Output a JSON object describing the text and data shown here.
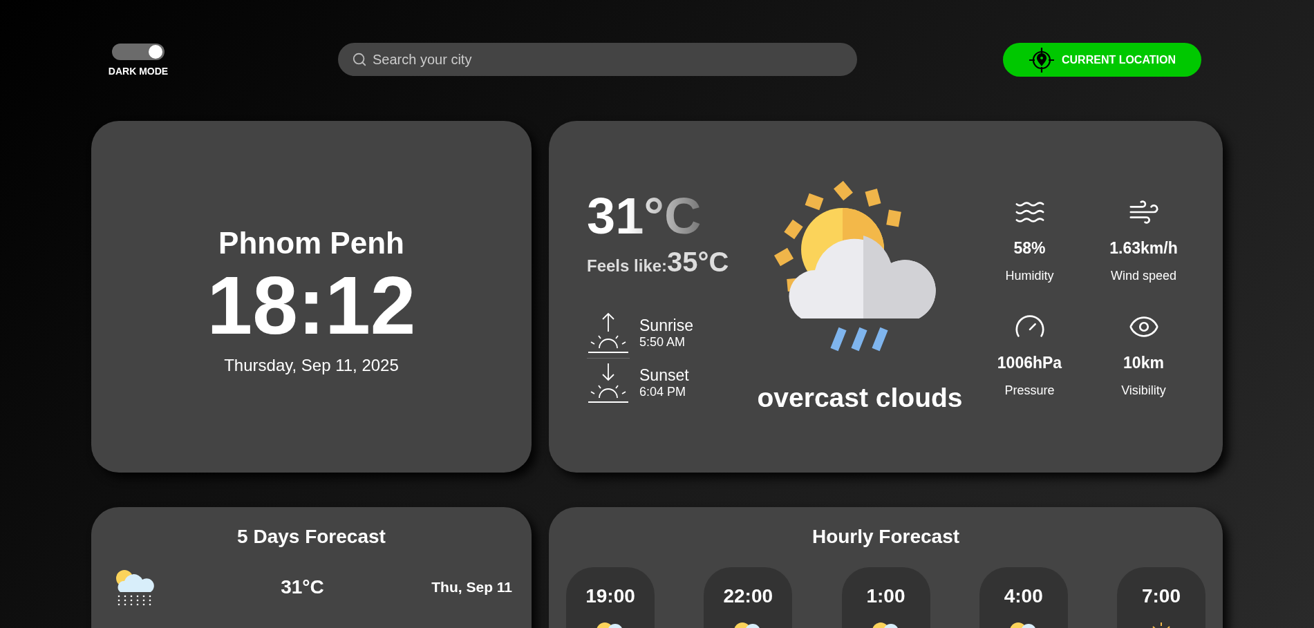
{
  "header": {
    "dark_mode": {
      "label": "DARK MODE",
      "on": true
    },
    "search": {
      "placeholder": "Search your city"
    },
    "location_button": {
      "label": "CURRENT LOCATION"
    }
  },
  "clock_card": {
    "city": "Phnom Penh",
    "time": "18:12",
    "date": "Thursday, Sep 11, 2025"
  },
  "current": {
    "temperature": "31°C",
    "feels_like_label": "Feels like:",
    "feels_like": "35°C",
    "condition": "overcast clouds",
    "sun_events": [
      {
        "kind": "sunrise",
        "label": "Sunrise",
        "time": "5:50 AM"
      },
      {
        "kind": "sunset",
        "label": "Sunset",
        "time": "6:04 PM"
      }
    ],
    "stats": [
      {
        "kind": "humidity",
        "value": "58%",
        "label": "Humidity"
      },
      {
        "kind": "wind",
        "value": "1.63km/h",
        "label": "Wind speed"
      },
      {
        "kind": "pressure",
        "value": "1006hPa",
        "label": "Pressure"
      },
      {
        "kind": "visibility",
        "value": "10km",
        "label": "Visibility"
      }
    ]
  },
  "daily": {
    "title": "5 Days Forecast",
    "days": [
      {
        "kind": "snow",
        "temperature": "31°C",
        "date": "Thu, Sep 11"
      }
    ]
  },
  "hourly": {
    "title": "Hourly Forecast",
    "hours": [
      {
        "time": "19:00",
        "kind": "cloud-sun"
      },
      {
        "time": "22:00",
        "kind": "cloud-sun"
      },
      {
        "time": "1:00",
        "kind": "cloud-sun"
      },
      {
        "time": "4:00",
        "kind": "cloud-sun"
      },
      {
        "time": "7:00",
        "kind": "sun"
      }
    ]
  }
}
